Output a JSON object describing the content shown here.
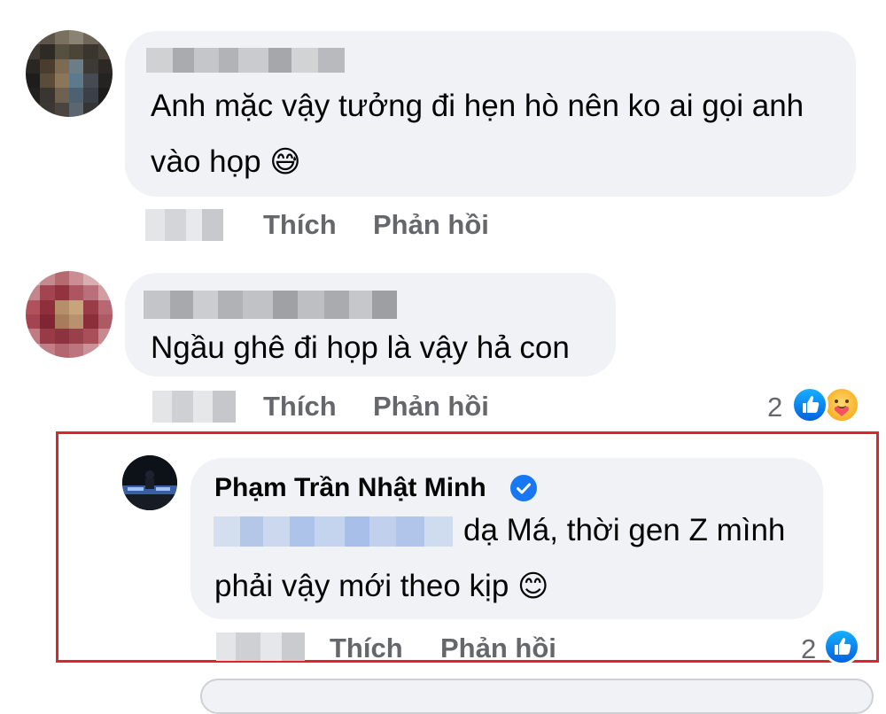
{
  "comments": [
    {
      "text_line1": "Anh mặc vậy tưởng đi hẹn hò nên ko ai gọi anh",
      "text_line2": "vào họp",
      "emoji": "😅",
      "like_label": "Thích",
      "reply_label": "Phản hồi"
    },
    {
      "text": "Ngầu ghê đi họp là vậy hả con",
      "like_label": "Thích",
      "reply_label": "Phản hồi",
      "reaction_count": "2",
      "reactions": [
        "like-icon",
        "care-icon"
      ]
    }
  ],
  "reply": {
    "author": "Phạm Trần Nhật Minh",
    "verified": true,
    "text_line1": "dạ Má, thời gen Z mình",
    "text_line2": "phải vậy mới theo kịp",
    "emoji": "😊",
    "like_label": "Thích",
    "reply_label": "Phản hồi",
    "reaction_count": "2",
    "reactions": [
      "like-icon"
    ]
  },
  "colors": {
    "bubble": "#f0f2f5",
    "highlight": "#e0242b",
    "action_text": "#65676b",
    "like_blue": "#1877f2"
  }
}
